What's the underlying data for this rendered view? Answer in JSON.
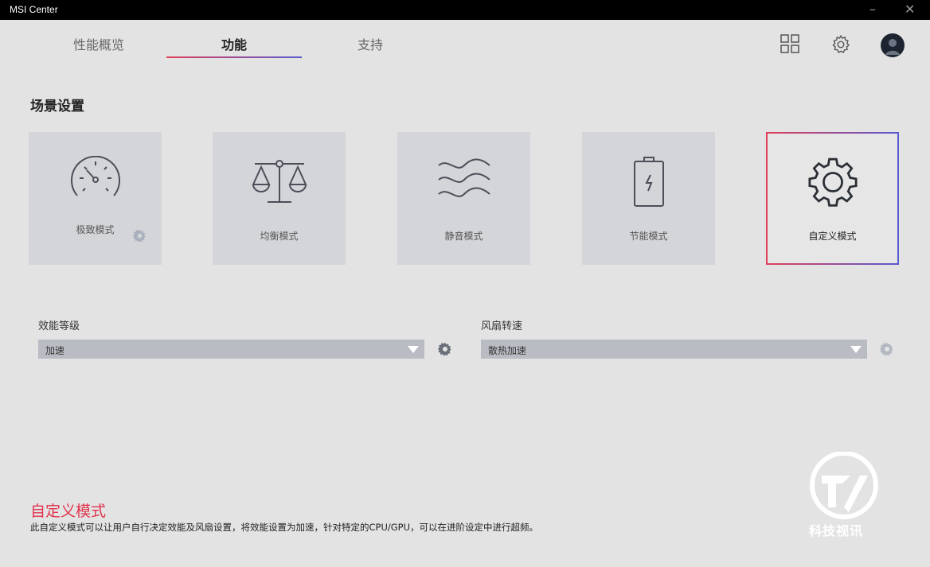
{
  "app": {
    "title": "MSI Center"
  },
  "tabs": [
    {
      "label": "性能概览"
    },
    {
      "label": "功能",
      "active": true
    },
    {
      "label": "支持"
    }
  ],
  "header_icons": [
    "grid-icon",
    "settings-icon",
    "avatar"
  ],
  "section_title": "场景设置",
  "modes": [
    {
      "label": "极致模式",
      "icon": "speedometer-icon",
      "has_gear": true
    },
    {
      "label": "均衡模式",
      "icon": "balance-scale-icon"
    },
    {
      "label": "静音模式",
      "icon": "waves-icon"
    },
    {
      "label": "节能模式",
      "icon": "battery-icon"
    },
    {
      "label": "自定义模式",
      "icon": "gear-icon",
      "selected": true
    }
  ],
  "performance": {
    "label": "效能等级",
    "value": "加速"
  },
  "fan": {
    "label": "风扇转速",
    "value": "散热加速"
  },
  "description": {
    "title": "自定义模式",
    "text": "此自定义模式可以让用户自行决定效能及风扇设置，将效能设置为加速，针对特定的CPU/GPU，可以在进阶设定中进行超频。"
  },
  "watermark": {
    "text": "科技视讯"
  },
  "colors": {
    "accent_red": "#e0344e",
    "accent_blue": "#5a5ad0",
    "card": "#d4d5d9",
    "select": "#b9bcc3"
  }
}
